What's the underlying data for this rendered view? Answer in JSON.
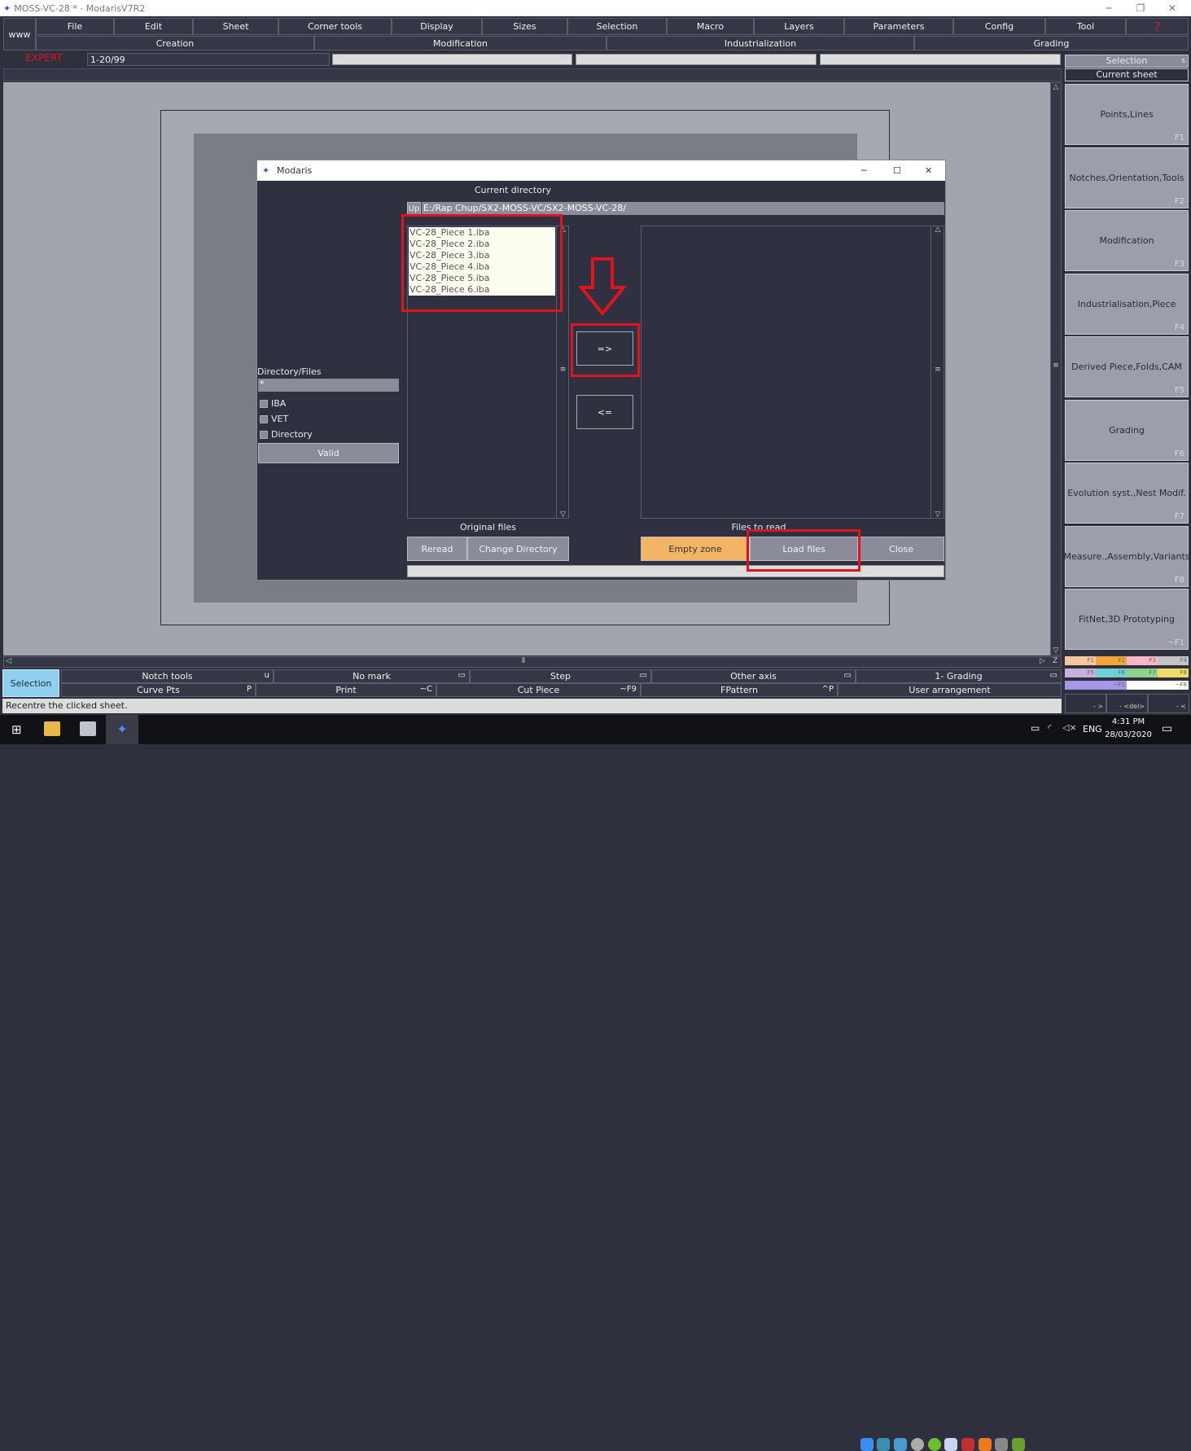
{
  "window": {
    "title": "MOSS-VC-28 *  - ModarisV7R2",
    "minimize": "─",
    "maximize": "❐",
    "close": "✕"
  },
  "menu": {
    "www": "www",
    "items": [
      "File",
      "Edit",
      "Sheet",
      "Corner tools",
      "Display",
      "Sizes",
      "Selection",
      "Macro",
      "Layers",
      "Parameters",
      "Config",
      "Tool",
      "?"
    ],
    "groups": [
      "Creation",
      "Modification",
      "Industrialization",
      "Grading"
    ]
  },
  "toolbar": {
    "mode": "EXPERT",
    "sheet_range": "1-20/99"
  },
  "right_panel": {
    "selection": "Selection",
    "selection_key": "s",
    "current_sheet": "Current sheet",
    "buttons": [
      {
        "label": "Points,Lines",
        "key": "F1"
      },
      {
        "label": "Notches,Orientation,Tools",
        "key": "F2"
      },
      {
        "label": "Modification",
        "key": "F3"
      },
      {
        "label": "Industrialisation,Piece",
        "key": "F4"
      },
      {
        "label": "Derived Piece,Folds,CAM",
        "key": "F5"
      },
      {
        "label": "Grading",
        "key": "F6"
      },
      {
        "label": "Evolution syst.,Nest Modif.",
        "key": "F7"
      },
      {
        "label": "Measure.,Assembly,Variants",
        "key": "F8"
      },
      {
        "label": "FitNet,3D Prototyping",
        "key": "~F1"
      }
    ],
    "swatches": [
      {
        "key": "F1",
        "color": "#f6c79c"
      },
      {
        "key": "F2",
        "color": "#f0a83c"
      },
      {
        "key": "F3",
        "color": "#f7b7c8"
      },
      {
        "key": "F4",
        "color": "#c4c4c4"
      },
      {
        "key": "F5",
        "color": "#c9b0d8"
      },
      {
        "key": "F6",
        "color": "#6fd0d6"
      },
      {
        "key": "F7",
        "color": "#8fd38a"
      },
      {
        "key": "F8",
        "color": "#f2da6a"
      }
    ],
    "wide_swatches": [
      {
        "key": "~F1",
        "color": "#a597e8"
      },
      {
        "key": "~F8",
        "color": "#ffffff"
      }
    ],
    "nav": [
      "- >",
      "- <del>",
      "- <"
    ]
  },
  "dialog": {
    "title": "Modaris",
    "current_directory_label": "Current directory",
    "up": "Up",
    "path": "E:/Rap Chup/SX2-MOSS-VC/SX2-MOSS-VC-28/",
    "files": [
      "VC-28_Piece 1.iba",
      "VC-28_Piece 2.iba",
      "VC-28_Piece 3.iba",
      "VC-28_Piece 4.iba",
      "VC-28_Piece 5.iba",
      "VC-28_Piece 6.iba"
    ],
    "filter_label": "Directory/Files",
    "filter_value": "*",
    "checkboxes": [
      "IBA",
      "VET",
      "Directory"
    ],
    "valid": "Valid",
    "add": "=>",
    "remove": "<=",
    "original_files": "Original files",
    "files_to_read": "Files to read",
    "reread": "Reread",
    "change_directory": "Change Directory",
    "empty_zone": "Empty zone",
    "load_files": "Load files",
    "close": "Close",
    "annotation_color": "#e0141e"
  },
  "bottom": {
    "selection": "Selection",
    "row1": [
      {
        "label": "Notch tools",
        "key": "u"
      },
      {
        "label": "No mark",
        "key": "▭"
      },
      {
        "label": "Step",
        "key": "▭"
      },
      {
        "label": "Other axis",
        "key": "▭"
      },
      {
        "label": "1- Grading",
        "key": "▭"
      }
    ],
    "row2": [
      {
        "label": "Curve Pts",
        "key": "P"
      },
      {
        "label": "Print",
        "key": "~C"
      },
      {
        "label": "Cut Piece",
        "key": "~F9"
      },
      {
        "label": "FPattern",
        "key": "^P"
      },
      {
        "label": "User arrangement",
        "key": ""
      }
    ],
    "status": "Recentre the clicked sheet."
  },
  "taskbar": {
    "lang": "ENG",
    "time": "4:31 PM",
    "date": "28/03/2020"
  }
}
